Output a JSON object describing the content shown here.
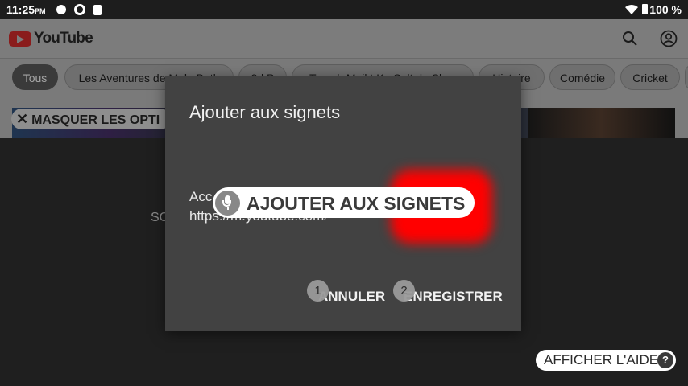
{
  "status_bar": {
    "time": "11:25",
    "ampm": "PM",
    "battery": "100 %"
  },
  "youtube": {
    "logo_text": "YouTube",
    "chips": [
      {
        "label": "Tous",
        "active": true
      },
      {
        "label": "Les Aventures de Mala Bath"
      },
      {
        "label": "3d P"
      },
      {
        "label": "Tomah Maikt Ko Salt de Slow"
      },
      {
        "label": "Histoire"
      },
      {
        "label": "Comédie"
      },
      {
        "label": "Cricket"
      }
    ],
    "hide_options_label": "MASQUER LES OPTI",
    "background_text": "SC"
  },
  "dialog": {
    "title": "Ajouter aux signets",
    "name_partial": "Acc",
    "url": "https://m.youtube.com/",
    "cancel_label": "ANNULER",
    "save_label": "ENREGISTRER",
    "badge_cancel": "1",
    "badge_save": "2"
  },
  "voice_overlay": {
    "command": "AJOUTER AUX SIGNETS"
  },
  "help_button": {
    "label": "AFFICHER L'AIDE",
    "icon_glyph": "?"
  },
  "colors": {
    "accent": "#ff0000",
    "dialog_bg": "#424242",
    "scrim": "#1f1f1f"
  }
}
